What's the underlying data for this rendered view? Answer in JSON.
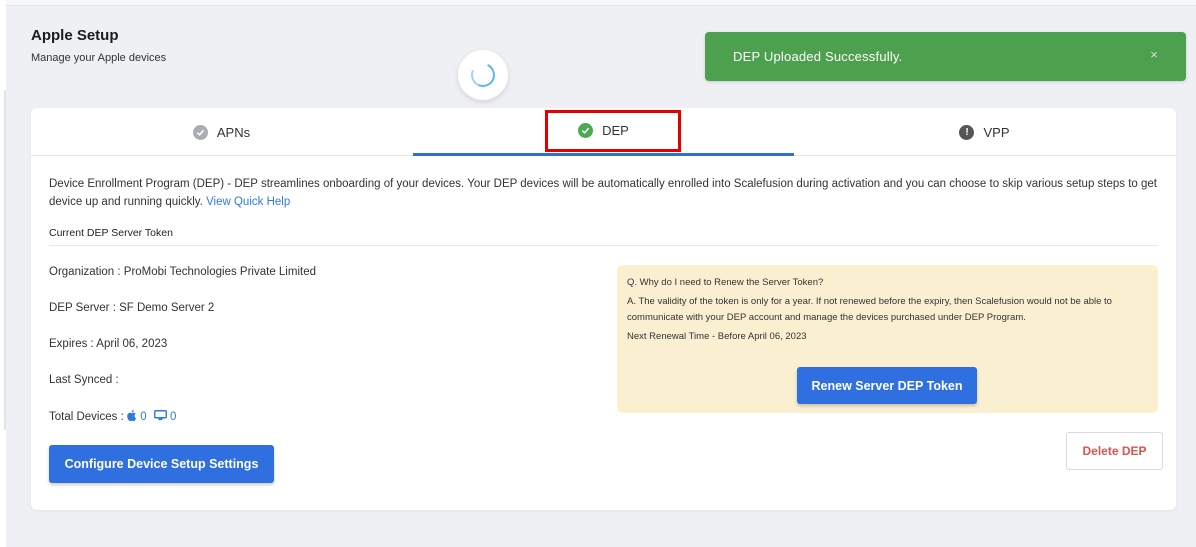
{
  "header": {
    "title": "Apple Setup",
    "subtitle": "Manage your Apple devices"
  },
  "toast": {
    "message": "DEP Uploaded Successfully.",
    "close": "×"
  },
  "tabs": [
    {
      "label": "APNs",
      "status": "neutral-check",
      "icon": "check-circle-icon"
    },
    {
      "label": "DEP",
      "status": "success",
      "icon": "check-circle-icon",
      "active": true
    },
    {
      "label": "VPP",
      "status": "warning",
      "icon": "exclamation-circle-icon"
    }
  ],
  "colors": {
    "accent": "#2f6fe0",
    "success": "#4aaa50",
    "toast": "#4da04d",
    "highlight": "#e50000",
    "danger": "#d9534f",
    "faq_background": "#fbefd1"
  },
  "description": {
    "text": "Device Enrollment Program (DEP) - DEP streamlines onboarding of your devices. Your DEP devices will be automatically enrolled into Scalefusion during activation and you can choose to skip various setup steps to get device up and running quickly.",
    "link": "View Quick Help"
  },
  "section_title": "Current DEP Server Token",
  "details": {
    "organization": "Organization : ProMobi Technologies Private Limited",
    "server": "DEP Server : SF Demo Server 2",
    "expires": "Expires : April 06, 2023",
    "last_synced": "Last Synced :",
    "total_label": "Total Devices :",
    "apple_count": "0",
    "mac_count": "0"
  },
  "faq": {
    "question": "Q. Why do I need to Renew the Server Token?",
    "answer": "A. The validity of the token is only for a year. If not renewed before the expiry, then Scalefusion would not be able to communicate with your DEP account and manage the devices purchased under DEP Program.",
    "renewal": "Next Renewal Time - Before April 06, 2023",
    "button": "Renew Server DEP Token"
  },
  "buttons": {
    "configure": "Configure Device Setup Settings",
    "delete": "Delete DEP"
  }
}
